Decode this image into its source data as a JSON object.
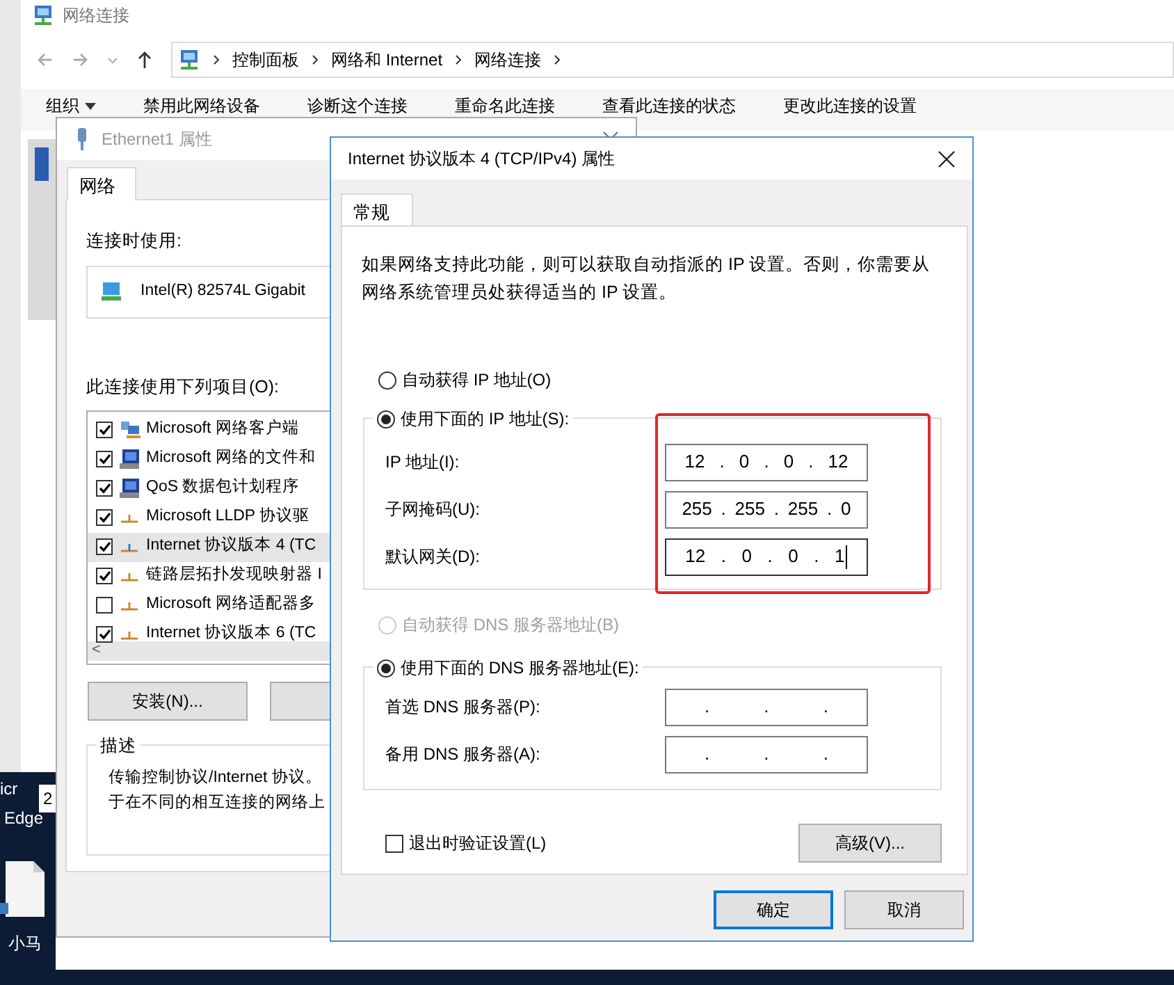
{
  "explorer": {
    "title": "网络连接",
    "breadcrumb": [
      "控制面板",
      "网络和 Internet",
      "网络连接"
    ],
    "toolbar": [
      {
        "label": "组织",
        "dropdown": true
      },
      {
        "label": "禁用此网络设备",
        "dropdown": false
      },
      {
        "label": "诊断这个连接",
        "dropdown": false
      },
      {
        "label": "重命名此连接",
        "dropdown": false
      },
      {
        "label": "查看此连接的状态",
        "dropdown": false
      },
      {
        "label": "更改此连接的设置",
        "dropdown": false
      }
    ]
  },
  "desktop": {
    "partial_label": "icr",
    "edge_label": "Edge",
    "count": "2",
    "file_label": "小马"
  },
  "ethernet_window": {
    "title": "Ethernet1 属性",
    "tabs": [
      {
        "label": "网络",
        "selected": true
      }
    ],
    "connect_using_label": "连接时使用:",
    "adapter": "Intel(R) 82574L Gigabit",
    "items_label": "此连接使用下列项目(O):",
    "items": [
      {
        "label": "Microsoft 网络客户端",
        "checked": true,
        "selected": false,
        "kind": "client"
      },
      {
        "label": "Microsoft 网络的文件和",
        "checked": true,
        "selected": false,
        "kind": "service"
      },
      {
        "label": "QoS 数据包计划程序",
        "checked": true,
        "selected": false,
        "kind": "service"
      },
      {
        "label": "Microsoft LLDP 协议驱",
        "checked": true,
        "selected": false,
        "kind": "protocol"
      },
      {
        "label": "Internet 协议版本 4 (TC",
        "checked": true,
        "selected": true,
        "kind": "protocol"
      },
      {
        "label": "链路层拓扑发现映射器 I",
        "checked": true,
        "selected": false,
        "kind": "protocol"
      },
      {
        "label": "Microsoft 网络适配器多",
        "checked": false,
        "selected": false,
        "kind": "protocol"
      },
      {
        "label": "Internet 协议版本 6 (TC",
        "checked": true,
        "selected": false,
        "kind": "protocol"
      }
    ],
    "scroll_left": "<",
    "install_button": "安装(N)...",
    "description_legend": "描述",
    "description_lines": [
      "传输控制协议/Internet 协议。",
      "于在不同的相互连接的网络上"
    ]
  },
  "ipv4_dialog": {
    "title": "Internet 协议版本 4 (TCP/IPv4) 属性",
    "tabs": [
      {
        "label": "常规",
        "selected": true
      }
    ],
    "intro": "如果网络支持此功能，则可以获取自动指派的 IP 设置。否则，你需要从网络系统管理员处获得适当的 IP 设置。",
    "ip_options": [
      {
        "label": "自动获得 IP 地址(O)",
        "selected": false,
        "disabled": false
      },
      {
        "label": "使用下面的 IP 地址(S):",
        "selected": true,
        "disabled": false
      }
    ],
    "ip_fields": [
      {
        "label": "IP 地址(I):",
        "parts": [
          "12",
          ".",
          "0",
          ".",
          "0",
          ".",
          "12"
        ],
        "focused": false
      },
      {
        "label": "子网掩码(U):",
        "parts": [
          "255",
          ".",
          "255",
          ".",
          "255",
          ".",
          "0"
        ],
        "focused": false
      },
      {
        "label": "默认网关(D):",
        "parts": [
          "12",
          ".",
          "0",
          ".",
          "0",
          ".",
          "1"
        ],
        "focused": true
      }
    ],
    "dns_options": [
      {
        "label": "自动获得 DNS 服务器地址(B)",
        "selected": false,
        "disabled": true
      },
      {
        "label": "使用下面的 DNS 服务器地址(E):",
        "selected": true,
        "disabled": false
      }
    ],
    "dns_fields": [
      {
        "label": "首选 DNS 服务器(P):",
        "parts": [
          ".",
          ".",
          "."
        ],
        "focused": false
      },
      {
        "label": "备用 DNS 服务器(A):",
        "parts": [
          ".",
          ".",
          "."
        ],
        "focused": false
      }
    ],
    "validate": {
      "label": "退出时验证设置(L)",
      "checked": false
    },
    "advanced_button": "高级(V)...",
    "footer_buttons": [
      {
        "label": "确定",
        "default": true
      },
      {
        "label": "取消",
        "default": false
      }
    ]
  }
}
